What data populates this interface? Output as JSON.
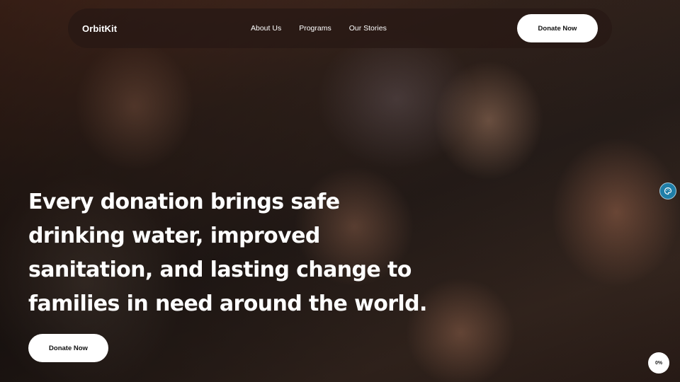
{
  "nav": {
    "brand": "OrbitKit",
    "links": [
      "About Us",
      "Programs",
      "Our Stories"
    ],
    "cta_label": "Donate Now"
  },
  "hero": {
    "headline": "Every donation brings safe drinking water, improved sanitation, and lasting change to families in need around the world.",
    "cta_label": "Donate Now"
  },
  "widgets": {
    "side_icon": "palette-icon",
    "progress_label": "0%",
    "progress_value": 0
  },
  "colors": {
    "widget_accent": "#1f7ea8",
    "button_bg": "#ffffff",
    "nav_bg": "#281814"
  }
}
